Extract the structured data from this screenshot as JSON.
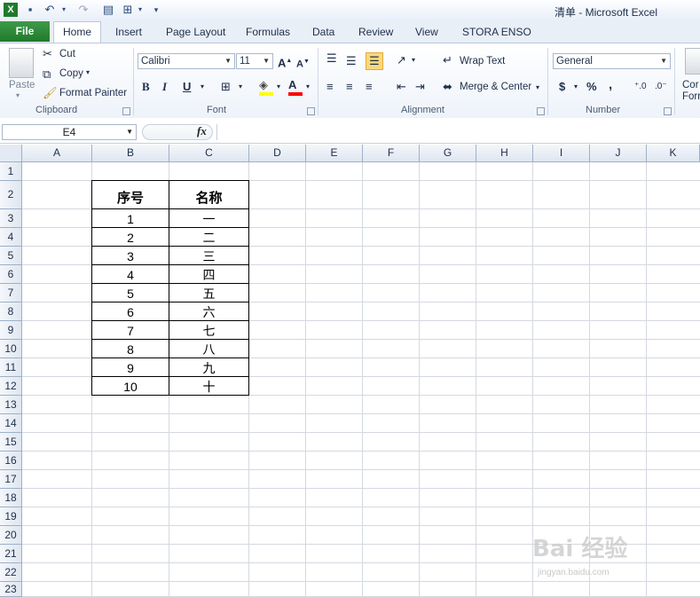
{
  "window": {
    "title": "清单  -  Microsoft Excel"
  },
  "quick_access": {
    "icons": [
      "excel-logo-icon",
      "save-icon",
      "undo-icon",
      "undo-dropdown-icon",
      "redo-icon",
      "print-preview-icon",
      "table-icon",
      "table-dropdown-icon",
      "customize-qat-icon"
    ]
  },
  "tabs": {
    "file": "File",
    "home": "Home",
    "insert": "Insert",
    "page_layout": "Page Layout",
    "formulas": "Formulas",
    "data": "Data",
    "review": "Review",
    "view": "View",
    "stora": "STORA ENSO"
  },
  "clipboard": {
    "paste": "Paste",
    "cut": "Cut",
    "copy": "Copy",
    "format_painter": "Format Painter",
    "label": "Clipboard"
  },
  "font": {
    "name": "Calibri",
    "size": "11",
    "bold": "B",
    "italic": "I",
    "underline": "U",
    "label": "Font",
    "fill_color": "#ffff00",
    "font_color": "#ff0000"
  },
  "alignment": {
    "wrap_text": "Wrap Text",
    "merge_center": "Merge & Center",
    "label": "Alignment"
  },
  "number": {
    "format": "General",
    "currency": "$",
    "percent": "%",
    "comma": ",",
    "label": "Number"
  },
  "styles": {
    "cond_format_1": "Cor",
    "cond_format_2": "Forr"
  },
  "formula_bar": {
    "name_box": "E4",
    "fx": "fx",
    "value": ""
  },
  "columns": [
    "A",
    "B",
    "C",
    "D",
    "E",
    "F",
    "G",
    "H",
    "I",
    "J",
    "K"
  ],
  "rows": [
    "1",
    "2",
    "3",
    "4",
    "5",
    "6",
    "7",
    "8",
    "9",
    "10",
    "11",
    "12",
    "13",
    "14",
    "15",
    "16",
    "17",
    "18",
    "19",
    "20",
    "21",
    "22",
    "23"
  ],
  "sheet": {
    "header": {
      "col_b": "序号",
      "col_c": "名称"
    },
    "data_rows": [
      {
        "b": "1",
        "c": "一"
      },
      {
        "b": "2",
        "c": "二"
      },
      {
        "b": "3",
        "c": "三"
      },
      {
        "b": "4",
        "c": "四"
      },
      {
        "b": "5",
        "c": "五"
      },
      {
        "b": "6",
        "c": "六"
      },
      {
        "b": "7",
        "c": "七"
      },
      {
        "b": "8",
        "c": "八"
      },
      {
        "b": "9",
        "c": "九"
      },
      {
        "b": "10",
        "c": "十"
      }
    ]
  },
  "watermark": {
    "main": "Bai 经验",
    "sub": "jingyan.baidu.com"
  }
}
